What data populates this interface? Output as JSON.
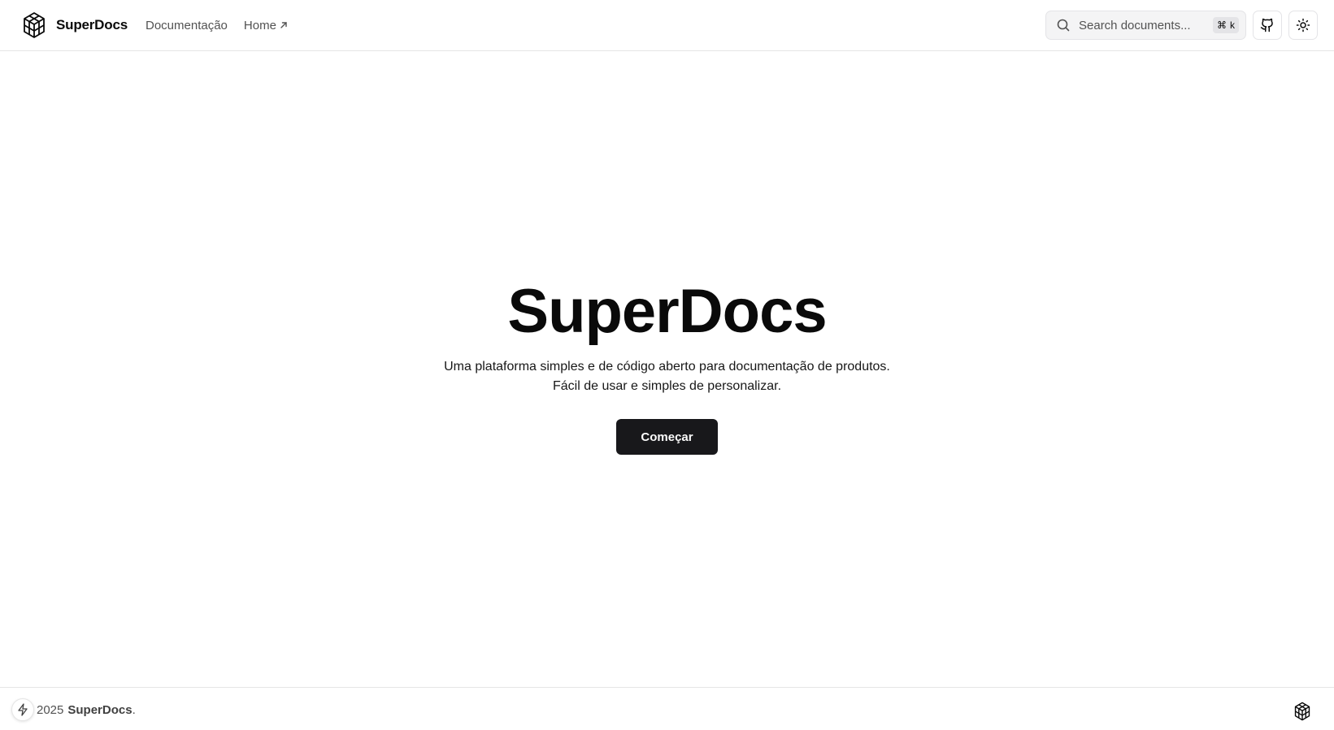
{
  "header": {
    "brand": "SuperDocs",
    "nav": [
      {
        "label": "Documentação",
        "external": false
      },
      {
        "label": "Home",
        "external": true,
        "icon": "arrow-up-right-icon"
      }
    ],
    "search": {
      "placeholder": "Search documents...",
      "shortcut_symbol": "⌘",
      "shortcut_key": "k"
    },
    "icons": {
      "logo": "cube-logo-icon",
      "github": "github-icon",
      "theme": "sun-icon"
    }
  },
  "hero": {
    "title": "SuperDocs",
    "description_line1": "Uma plataforma simples e de código aberto para documentação de produtos.",
    "description_line2": "Fácil de usar e simples de personalizar.",
    "cta_label": "Começar"
  },
  "footer": {
    "year": "2025",
    "brand": "SuperDocs",
    "suffix": ".",
    "icons": {
      "bolt": "bolt-icon",
      "logo": "cube-logo-icon"
    }
  },
  "colors": {
    "primary": "#18181b",
    "text": "#0a0a0a",
    "muted": "#525252",
    "border": "#e5e5e5"
  }
}
